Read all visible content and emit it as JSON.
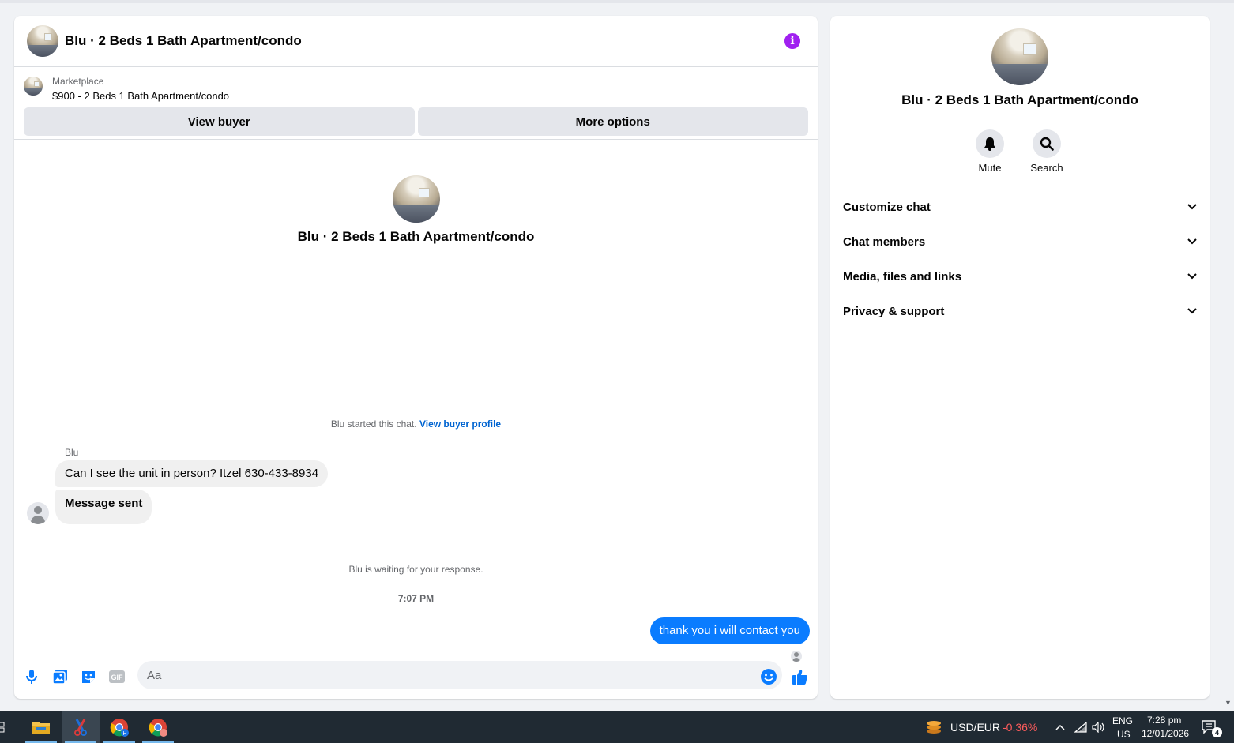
{
  "header": {
    "title": "Blu · 2 Beds 1 Bath Apartment/condo"
  },
  "listing": {
    "category": "Marketplace",
    "price_title": "$900 - 2 Beds 1 Bath Apartment/condo",
    "view_buyer_label": "View buyer",
    "more_options_label": "More options"
  },
  "intro": {
    "title": "Blu · 2 Beds 1 Bath Apartment/condo"
  },
  "conversation": {
    "started_text": "Blu started this chat.",
    "view_buyer_profile_link": "View buyer profile",
    "sender_name": "Blu",
    "incoming_messages": [
      "Can I see the unit in person? Itzel 630-433-8934",
      "Message sent"
    ],
    "waiting_text": "Blu is waiting for your response.",
    "timestamp": "7:07 PM",
    "outgoing_message": "thank you i will contact you"
  },
  "composer": {
    "placeholder": "Aa",
    "icons": [
      "microphone-icon",
      "photo-icon",
      "sticker-icon",
      "gif-icon",
      "emoji-icon",
      "thumbs-up-icon"
    ],
    "gif_label": "GIF"
  },
  "side_panel": {
    "title": "Blu · 2 Beds 1 Bath Apartment/condo",
    "actions": [
      {
        "label": "Mute",
        "icon": "bell-icon"
      },
      {
        "label": "Search",
        "icon": "search-icon"
      }
    ],
    "sections": [
      {
        "label": "Customize chat"
      },
      {
        "label": "Chat members"
      },
      {
        "label": "Media, files and links"
      },
      {
        "label": "Privacy & support"
      }
    ]
  },
  "taskbar": {
    "currency_pair": "USD/EUR",
    "currency_change": "-0.36%",
    "language_line1": "ENG",
    "language_line2": "US",
    "time": "7:28 pm",
    "date": "12/01/2026",
    "notification_count": "4"
  },
  "colors": {
    "accent": "#0a7cff",
    "link": "#0064d1",
    "info": "#a020f0",
    "negative": "#ff5c5c"
  }
}
